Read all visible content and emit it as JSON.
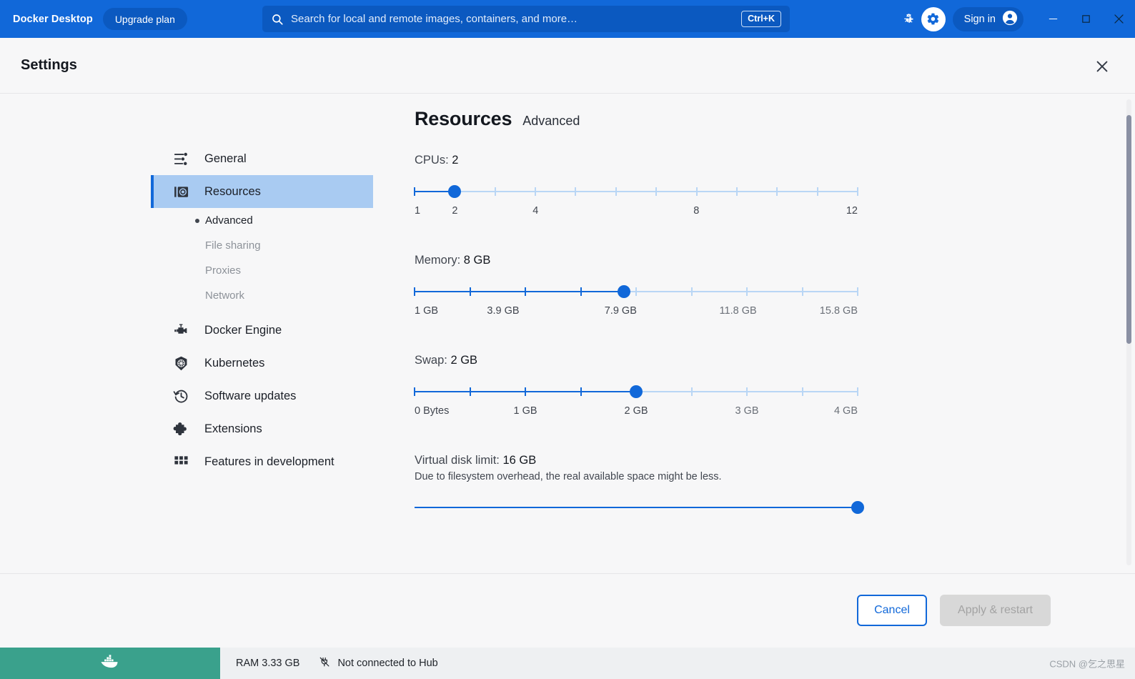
{
  "titlebar": {
    "brand": "Docker Desktop",
    "upgrade_label": "Upgrade plan",
    "search_placeholder": "Search for local and remote images, containers, and more…",
    "search_value": "",
    "shortcut": "Ctrl+K",
    "signin_label": "Sign in",
    "accent": "#1168d9",
    "accent_dark": "#0b59c0"
  },
  "settings": {
    "title": "Settings"
  },
  "sidebar": {
    "items": [
      {
        "label": "General",
        "icon": "sliders-icon",
        "selected": false
      },
      {
        "label": "Resources",
        "icon": "resources-icon",
        "selected": true
      },
      {
        "label": "Docker Engine",
        "icon": "engine-icon",
        "selected": false
      },
      {
        "label": "Kubernetes",
        "icon": "kubernetes-icon",
        "selected": false
      },
      {
        "label": "Software updates",
        "icon": "history-icon",
        "selected": false
      },
      {
        "label": "Extensions",
        "icon": "puzzle-icon",
        "selected": false
      },
      {
        "label": "Features in development",
        "icon": "grid-icon",
        "selected": false
      }
    ],
    "sub_items": [
      {
        "label": "Advanced",
        "active": true
      },
      {
        "label": "File sharing",
        "active": false
      },
      {
        "label": "Proxies",
        "active": false
      },
      {
        "label": "Network",
        "active": false
      }
    ]
  },
  "main": {
    "title": "Resources",
    "subtitle": "Advanced",
    "sliders": [
      {
        "name": "cpus",
        "label_prefix": "CPUs: ",
        "value_text": "2",
        "min": 1,
        "max": 12,
        "value": 2,
        "tick_count": 12,
        "fill_percent": 9.1,
        "thumb_percent": 9.1,
        "ticks_on": 1,
        "tick_labels": [
          {
            "text": "1",
            "percent": 0
          },
          {
            "text": "2",
            "percent": 9.1
          },
          {
            "text": "4",
            "percent": 27.3
          },
          {
            "text": "8",
            "percent": 63.6
          },
          {
            "text": "12",
            "percent": 100
          }
        ]
      },
      {
        "name": "memory",
        "label_prefix": "Memory: ",
        "value_text": "8 GB",
        "min": 1,
        "max": 15.8,
        "value": 8,
        "tick_count": 9,
        "fill_percent": 47.2,
        "thumb_percent": 47.2,
        "ticks_on": 4,
        "tick_labels": [
          {
            "text": "1 GB",
            "percent": 0,
            "dim": false
          },
          {
            "text": "3.9 GB",
            "percent": 20,
            "dim": false
          },
          {
            "text": "7.9 GB",
            "percent": 46.5,
            "dim": false
          },
          {
            "text": "11.8 GB",
            "percent": 73,
            "dim": true
          },
          {
            "text": "15.8 GB",
            "percent": 100,
            "dim": true
          }
        ]
      },
      {
        "name": "swap",
        "label_prefix": "Swap: ",
        "value_text": "2 GB",
        "min": 0,
        "max": 4,
        "value": 2,
        "tick_count": 9,
        "fill_percent": 50,
        "thumb_percent": 50,
        "ticks_on": 4,
        "tick_labels": [
          {
            "text": "0 Bytes",
            "percent": 0,
            "dim": false
          },
          {
            "text": "1 GB",
            "percent": 25,
            "dim": false
          },
          {
            "text": "2 GB",
            "percent": 50,
            "dim": false
          },
          {
            "text": "3 GB",
            "percent": 75,
            "dim": true
          },
          {
            "text": "4 GB",
            "percent": 100,
            "dim": true
          }
        ]
      },
      {
        "name": "virtual-disk-limit",
        "label_prefix": "Virtual disk limit: ",
        "value_text": "16 GB",
        "description": "Due to filesystem overhead, the real available space might be less.",
        "min": 0,
        "max": 16,
        "value": 16,
        "tick_count": 0,
        "fill_percent": 100,
        "thumb_percent": 100,
        "ticks_on": 0,
        "tick_labels": []
      }
    ]
  },
  "footer": {
    "cancel_label": "Cancel",
    "apply_label": "Apply & restart"
  },
  "statusbar": {
    "ram": "RAM 3.33 GB",
    "hub_status": "Not connected to Hub",
    "watermark": "CSDN @乞之思星",
    "green": "#3aa18c"
  }
}
